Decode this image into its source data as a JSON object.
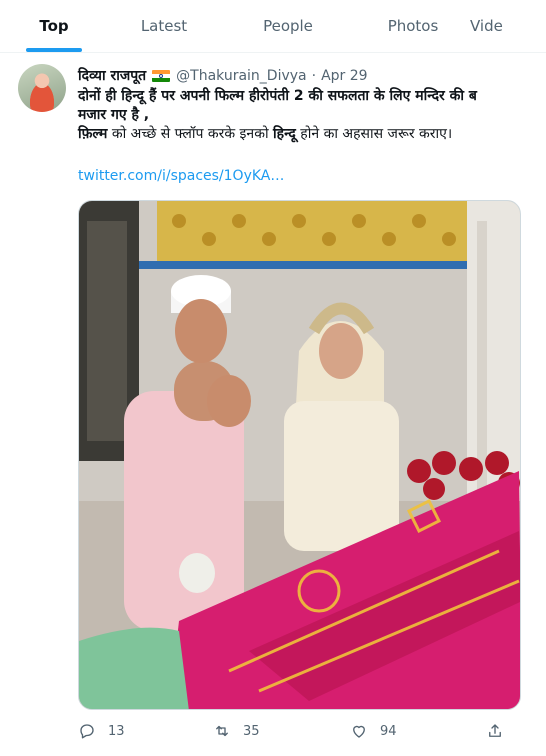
{
  "tabs": [
    {
      "label": "Top",
      "active": true
    },
    {
      "label": "Latest",
      "active": false
    },
    {
      "label": "People",
      "active": false
    },
    {
      "label": "Photos",
      "active": false
    },
    {
      "label": "Vide",
      "active": false
    }
  ],
  "tweet": {
    "display_name": "दिव्या राजपूत",
    "flag_icon": "india-flag-icon",
    "handle": "@Thakurain_Divya",
    "separator": "·",
    "date": "Apr 29",
    "text_line1_a": "दोनों ही ",
    "text_line1_b": "हिन्दू",
    "text_line1_c": " हैं पर अपनी फिल्म हीरोपंती 2 की सफलता के लिए मन्दिर की ब",
    "text_line2": "मजार गए है ,",
    "text_line3_a": "फ़िल्म",
    "text_line3_b": " को अच्छे से फ्लॉप करके इनको ",
    "text_line3_c": "हिन्दू",
    "text_line3_d": " होने का अहसास जरूर कराए।",
    "link": "twitter.com/i/spaces/1OyKA…",
    "reply_count": "13",
    "retweet_count": "35",
    "like_count": "94"
  },
  "colors": {
    "accent": "#1d9bf0",
    "muted": "#536471",
    "text": "#0f1419"
  }
}
